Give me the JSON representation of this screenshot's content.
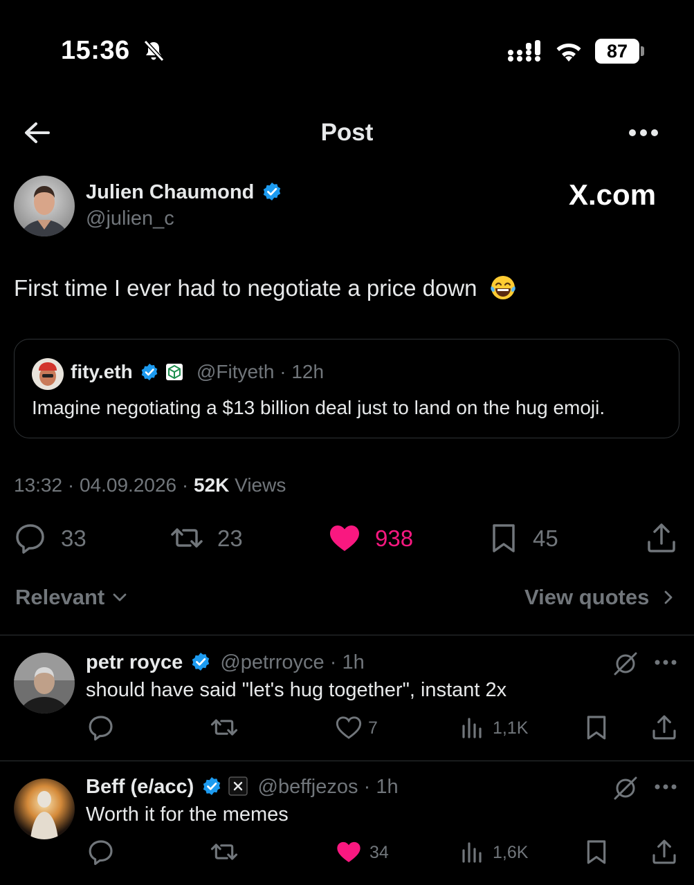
{
  "status_bar": {
    "time": "15:36",
    "battery": "87"
  },
  "header": {
    "title": "Post"
  },
  "post": {
    "author_name": "Julien Chaumond",
    "handle": "@julien_c",
    "watermark": "X.com",
    "text": "First time I ever had to negotiate a price down",
    "emoji": "laughing-tears",
    "quote": {
      "name": "fity.eth",
      "handle": "@Fityeth",
      "sep": "·",
      "time": "12h",
      "text": "Imagine negotiating a $13 billion deal just to land on the hug emoji."
    },
    "time": "13:32",
    "date": "04.09.2026",
    "views_count": "52K",
    "views_label": "Views",
    "replies": "33",
    "reposts": "23",
    "likes": "938",
    "bookmarks": "45"
  },
  "sort": {
    "label": "Relevant",
    "view_quotes": "View quotes"
  },
  "replies": [
    {
      "name": "petr royce",
      "handle": "@petrroyce",
      "sep": "·",
      "time": "1h",
      "text": "should have said \"let's hug together\", instant 2x",
      "likes": "7",
      "views": "1,1K",
      "liked": false
    },
    {
      "name": "Beff (e/acc)",
      "handle": "@beffjezos",
      "sep": "·",
      "time": "1h",
      "text": "Worth it for the memes",
      "likes": "34",
      "views": "1,6K",
      "liked": true
    }
  ],
  "colors": {
    "accent": "#1d9bf0",
    "like": "#f91880",
    "muted": "#71767b",
    "text": "#e7e9ea",
    "background": "#000000"
  }
}
